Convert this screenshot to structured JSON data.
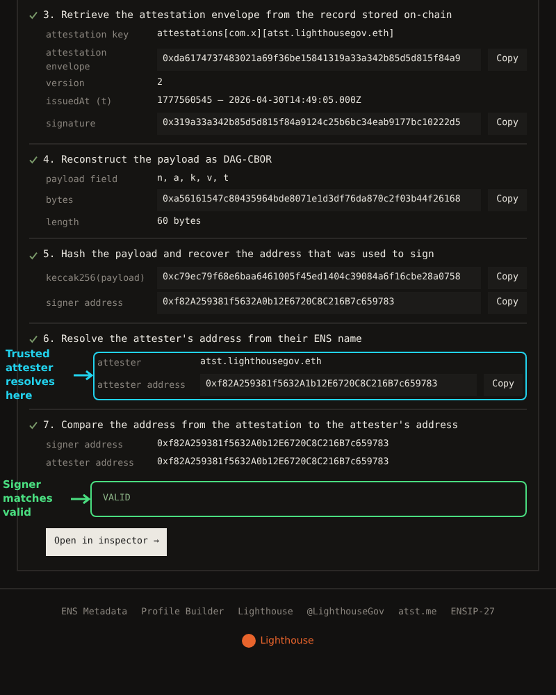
{
  "steps": [
    {
      "number": "3.",
      "title": "Retrieve the attestation envelope from the record stored on-chain",
      "done": true,
      "fields": [
        {
          "label": "attestation key",
          "value": "attestations[com.x][atst.lighthousegov.eth]",
          "kind": "plain"
        },
        {
          "label": "attestation envelope",
          "value": "0xda6174737483021a69f36be15841319a33a342b85d5d815f84a9",
          "kind": "boxed",
          "copy": "Copy"
        },
        {
          "label": "version",
          "value": "2",
          "kind": "plain"
        },
        {
          "label": "issuedAt (t)",
          "value": "1777560545 — 2026-04-30T14:49:05.000Z",
          "kind": "plain"
        },
        {
          "label": "signature",
          "value": "0x319a33a342b85d5d815f84a9124c25b6bc34eab9177bc10222d5",
          "kind": "boxed",
          "copy": "Copy"
        }
      ]
    },
    {
      "number": "4.",
      "title": "Reconstruct the payload as DAG-CBOR",
      "done": true,
      "fields": [
        {
          "label": "payload field",
          "value": "n, a, k, v, t",
          "kind": "plain"
        },
        {
          "label": "bytes",
          "value": "0xa56161547c80435964bde8071e1d3df76da870c2f03b44f26168",
          "kind": "boxed",
          "copy": "Copy"
        },
        {
          "label": "length",
          "value": "60 bytes",
          "kind": "plain"
        }
      ]
    },
    {
      "number": "5.",
      "title": "Hash the payload and recover the address that was used to sign",
      "done": true,
      "fields": [
        {
          "label": "keccak256(payload)",
          "value": "0xc79ec79f68e6baa6461005f45ed1404c39084a6f16cbe28a0758",
          "kind": "boxed",
          "copy": "Copy"
        },
        {
          "label": "signer address",
          "value": "0xf82A259381f5632A0b12E6720C8C216B7c659783",
          "kind": "boxed",
          "copy": "Copy"
        }
      ]
    },
    {
      "number": "6.",
      "title": "Resolve the attester's address from their ENS name",
      "done": true,
      "highlight": {
        "note": "Trusted attester resolves here",
        "color": "#22d3ee"
      },
      "fields": [
        {
          "label": "attester",
          "value": "atst.lighthousegov.eth",
          "kind": "plain"
        },
        {
          "label": "attester address",
          "value": "0xf82A259381f5632A1b12E6720C8C216B7c659783",
          "kind": "boxed",
          "copy": "Copy"
        }
      ]
    },
    {
      "number": "7.",
      "title": "Compare the address from the attestation to the attester's address",
      "done": true,
      "fields": [
        {
          "label": "signer address",
          "value": "0xf82A259381f5632A0b12E6720C8C216B7c659783",
          "kind": "plain"
        },
        {
          "label": "attester address",
          "value": "0xf82A259381f5632A0b12E6720C8C216B7c659783",
          "kind": "plain"
        }
      ],
      "result": {
        "text": "VALID",
        "note": "Signer matches valid",
        "color": "#4ade80"
      }
    }
  ],
  "action": "Open in inspector →",
  "footer_links": [
    "ENS Metadata",
    "Profile Builder",
    "Lighthouse",
    "@LighthouseGov",
    "atst.me",
    "ENSIP-27"
  ],
  "brand": "Lighthouse"
}
